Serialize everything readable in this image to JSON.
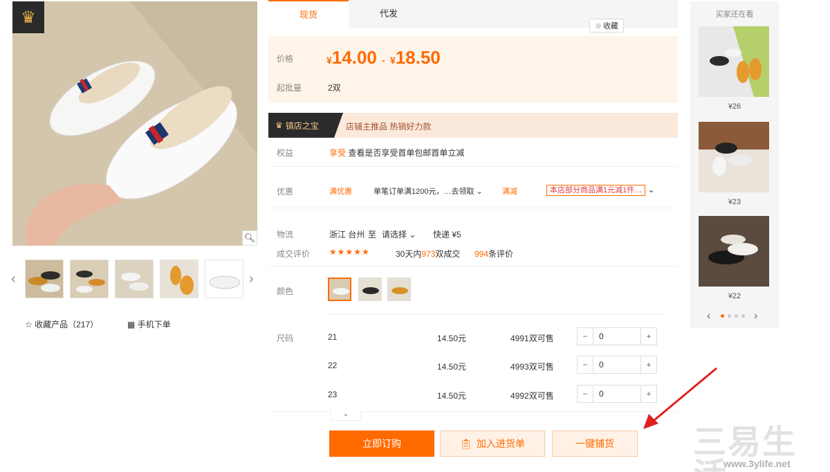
{
  "gallery": {
    "fav_label": "收藏产品（217）",
    "mobile_label": "手机下单"
  },
  "tabs": [
    {
      "label": "现货"
    },
    {
      "label": "代发"
    }
  ],
  "collect_label": "收藏",
  "price": {
    "label": "价格",
    "low": "14.00",
    "high": "18.50",
    "currency": "¥",
    "sep": "-",
    "moq_label": "起批量",
    "moq_value": "2双"
  },
  "store": {
    "badge": "镇店之宝",
    "text": "店铺主推品  热销好力款"
  },
  "rights": {
    "label": "权益",
    "tag": "享受",
    "text": "查看是否享受首单包邮首单立减"
  },
  "promo": {
    "label": "优惠",
    "coupon_label": "满优惠",
    "coupon_text": "单笔订单满1200元，…去领取",
    "discount_label": "满减",
    "discount_text": "本店部分商品满1元减1件…"
  },
  "shipping": {
    "label": "物流",
    "origin": "浙江 台州",
    "to": "至",
    "dest": "请选择",
    "fee": "快递 ¥5"
  },
  "rating": {
    "label": "成交评价",
    "stars": "★★★★★",
    "sales_prefix": "30天内",
    "sales_count": "973",
    "sales_suffix": "双成交",
    "reviews_count": "994",
    "reviews_suffix": "条评价"
  },
  "color": {
    "label": "颜色"
  },
  "sizes": {
    "label": "尺码",
    "rows": [
      {
        "size": "21",
        "price": "14.50元",
        "stock": "4991双可售",
        "qty": "0"
      },
      {
        "size": "22",
        "price": "14.50元",
        "stock": "4993双可售",
        "qty": "0"
      },
      {
        "size": "23",
        "price": "14.50元",
        "stock": "4992双可售",
        "qty": "0"
      }
    ]
  },
  "actions": {
    "buy": "立即订购",
    "cart": "加入进货单",
    "onekey": "一键铺货"
  },
  "recommend": {
    "title": "买家还在看",
    "items": [
      {
        "price": "¥26"
      },
      {
        "price": "¥23"
      },
      {
        "price": "¥22"
      }
    ]
  },
  "watermark": {
    "brand": "三易生活",
    "url": "www.3ylife.net"
  },
  "colors": {
    "accent": "#ff6a00",
    "price_bg": "#fff4ea",
    "arrow": "#e02020"
  }
}
